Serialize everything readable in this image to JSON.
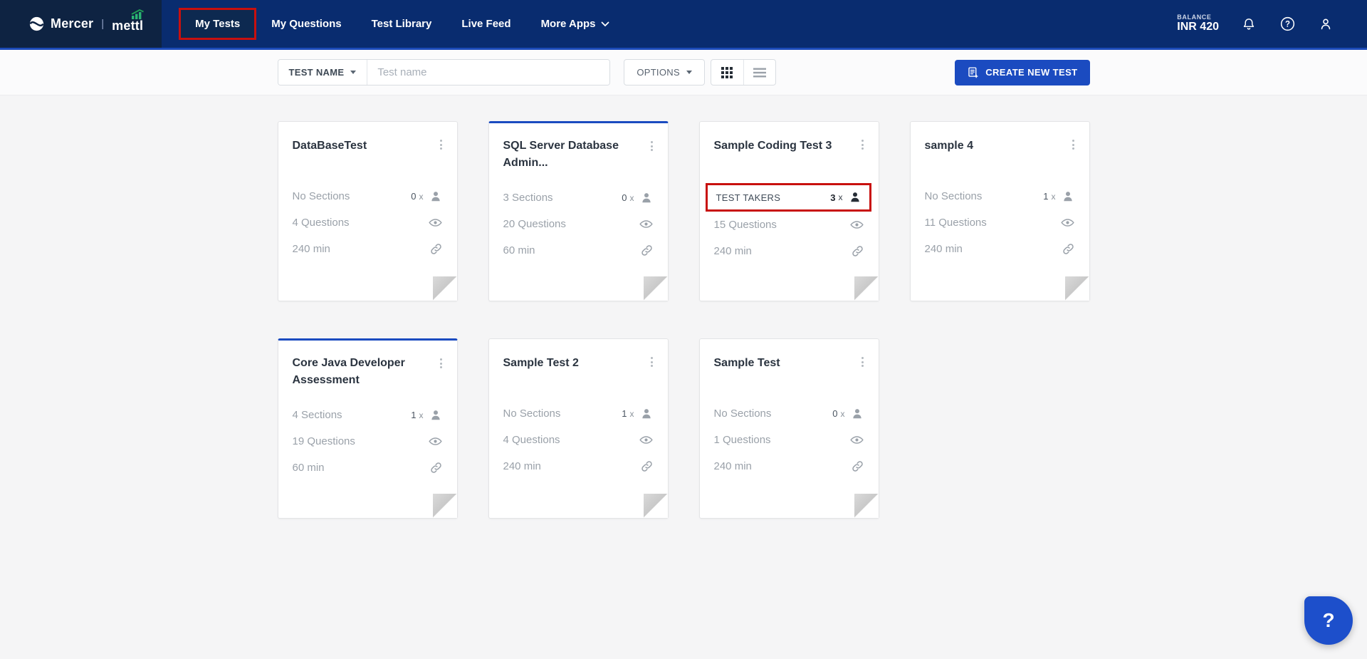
{
  "topbar": {
    "brand": {
      "mercer": "Mercer",
      "separator": "|",
      "mettl": "mettl"
    },
    "nav": [
      {
        "label": "My Tests",
        "active": true,
        "annotated": true
      },
      {
        "label": "My Questions"
      },
      {
        "label": "Test Library"
      },
      {
        "label": "Live Feed"
      },
      {
        "label": "More Apps",
        "has_chevron": true
      }
    ],
    "balance": {
      "label": "BALANCE",
      "value": "INR 420"
    }
  },
  "filterbar": {
    "field_selector_label": "TEST NAME",
    "search_placeholder": "Test name",
    "options_label": "OPTIONS",
    "create_button_label": "CREATE NEW TEST"
  },
  "ui": {
    "times_symbol": "x"
  },
  "cards": [
    {
      "title": "DataBaseTest",
      "selected": false,
      "row1_label": "No Sections",
      "row1_highlighted": false,
      "takers_count": "0",
      "questions": "4 Questions",
      "duration": "240 min"
    },
    {
      "title": "SQL Server Database Admin...",
      "selected": true,
      "row1_label": "3 Sections",
      "row1_highlighted": false,
      "takers_count": "0",
      "questions": "20 Questions",
      "duration": "60 min"
    },
    {
      "title": "Sample Coding Test 3",
      "selected": false,
      "row1_label": "TEST TAKERS",
      "row1_highlighted": true,
      "takers_count": "3",
      "questions": "15 Questions",
      "duration": "240 min"
    },
    {
      "title": "sample 4",
      "selected": false,
      "row1_label": "No Sections",
      "row1_highlighted": false,
      "takers_count": "1",
      "questions": "11 Questions",
      "duration": "240 min"
    },
    {
      "title": "Core Java Developer Assessment",
      "selected": true,
      "row1_label": "4 Sections",
      "row1_highlighted": false,
      "takers_count": "1",
      "questions": "19 Questions",
      "duration": "60 min"
    },
    {
      "title": "Sample Test 2",
      "selected": false,
      "row1_label": "No Sections",
      "row1_highlighted": false,
      "takers_count": "1",
      "questions": "4 Questions",
      "duration": "240 min"
    },
    {
      "title": "Sample Test",
      "selected": false,
      "row1_label": "No Sections",
      "row1_highlighted": false,
      "takers_count": "0",
      "questions": "1 Questions",
      "duration": "240 min"
    }
  ],
  "help_fab": {
    "label": "?"
  },
  "colors": {
    "navbar_bg": "#092c6f",
    "navbar_edge": "#1c4bb8",
    "brand_bg": "#0e2342",
    "active_nav_bg": "#0d2950",
    "annotation_red": "#c8100e",
    "accent_blue": "#1b4bc0",
    "page_bg": "#f5f5f6",
    "green": "#2bb673"
  }
}
